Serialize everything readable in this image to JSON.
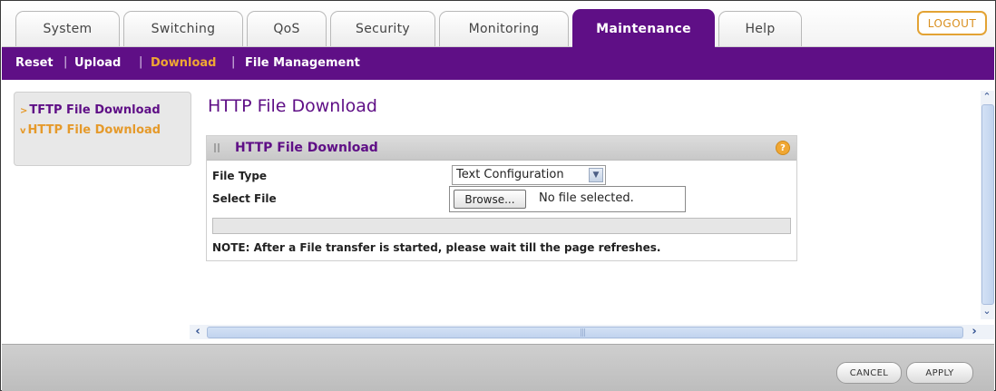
{
  "top_tabs": [
    {
      "label": "System",
      "active": false
    },
    {
      "label": "Switching",
      "active": false
    },
    {
      "label": "QoS",
      "active": false
    },
    {
      "label": "Security",
      "active": false
    },
    {
      "label": "Monitoring",
      "active": false
    },
    {
      "label": "Maintenance",
      "active": true
    },
    {
      "label": "Help",
      "active": false
    }
  ],
  "logout_label": "LOGOUT",
  "subnav": {
    "items": [
      "Reset",
      "Upload",
      "Download",
      "File Management"
    ],
    "separator": "|",
    "current": "Download"
  },
  "left_menu": {
    "items": [
      {
        "label": "TFTP File Download",
        "marker": ">"
      },
      {
        "label": "HTTP File Download",
        "marker": "v",
        "selected": true
      }
    ]
  },
  "page_title": "HTTP File Download",
  "panel": {
    "title": "HTTP File Download",
    "help_glyph": "?",
    "file_type_label": "File Type",
    "file_type_value": "Text Configuration",
    "select_file_label": "Select File",
    "browse_label": "Browse...",
    "no_file_text": "No file selected.",
    "note": "NOTE: After a File transfer is started, please wait till the page refreshes."
  },
  "footer": {
    "cancel_label": "CANCEL",
    "apply_label": "APPLY"
  },
  "colors": {
    "brand_purple": "#5f0f86",
    "accent_orange": "#e59a2b"
  }
}
